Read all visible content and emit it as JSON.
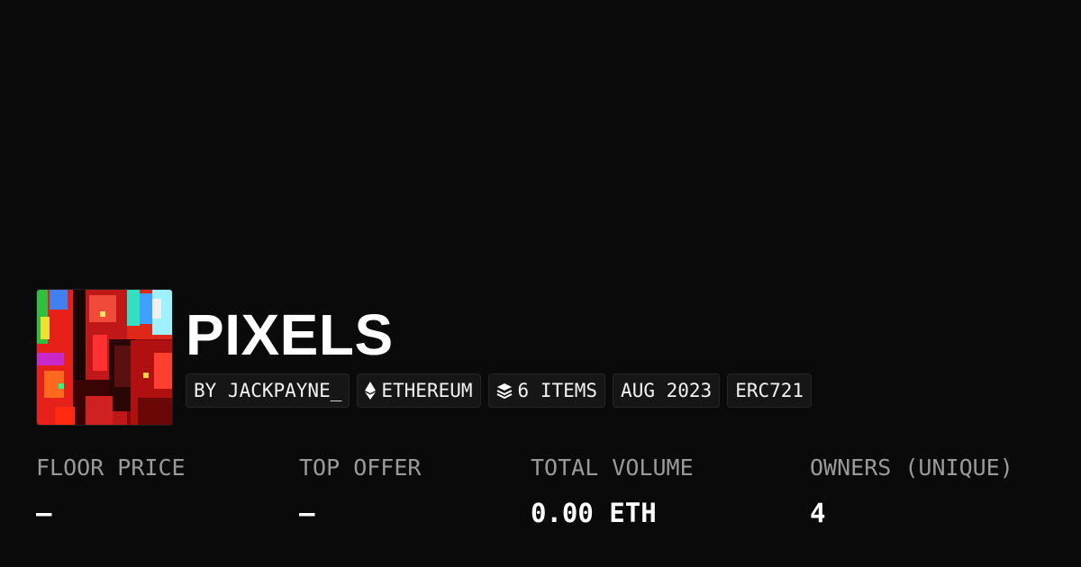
{
  "collection": {
    "title": "PIXELS",
    "thumbnail_icon": "collection-thumbnail"
  },
  "chips": {
    "creator": "BY JACKPAYNE_",
    "chain": "ETHEREUM",
    "chain_icon": "ethereum-icon",
    "items": "6 ITEMS",
    "items_icon": "layers-icon",
    "date": "AUG 2023",
    "standard": "ERC721"
  },
  "stats": {
    "floor_price": {
      "label": "FLOOR PRICE",
      "value": "–"
    },
    "top_offer": {
      "label": "TOP OFFER",
      "value": "–"
    },
    "total_volume": {
      "label": "TOTAL VOLUME",
      "value": "0.00 ETH"
    },
    "owners": {
      "label": "OWNERS (UNIQUE)",
      "value": "4"
    }
  },
  "colors": {
    "background": "#0a0a0a",
    "chip_bg": "#161616",
    "label": "#9a9a9a",
    "text": "#ffffff"
  }
}
